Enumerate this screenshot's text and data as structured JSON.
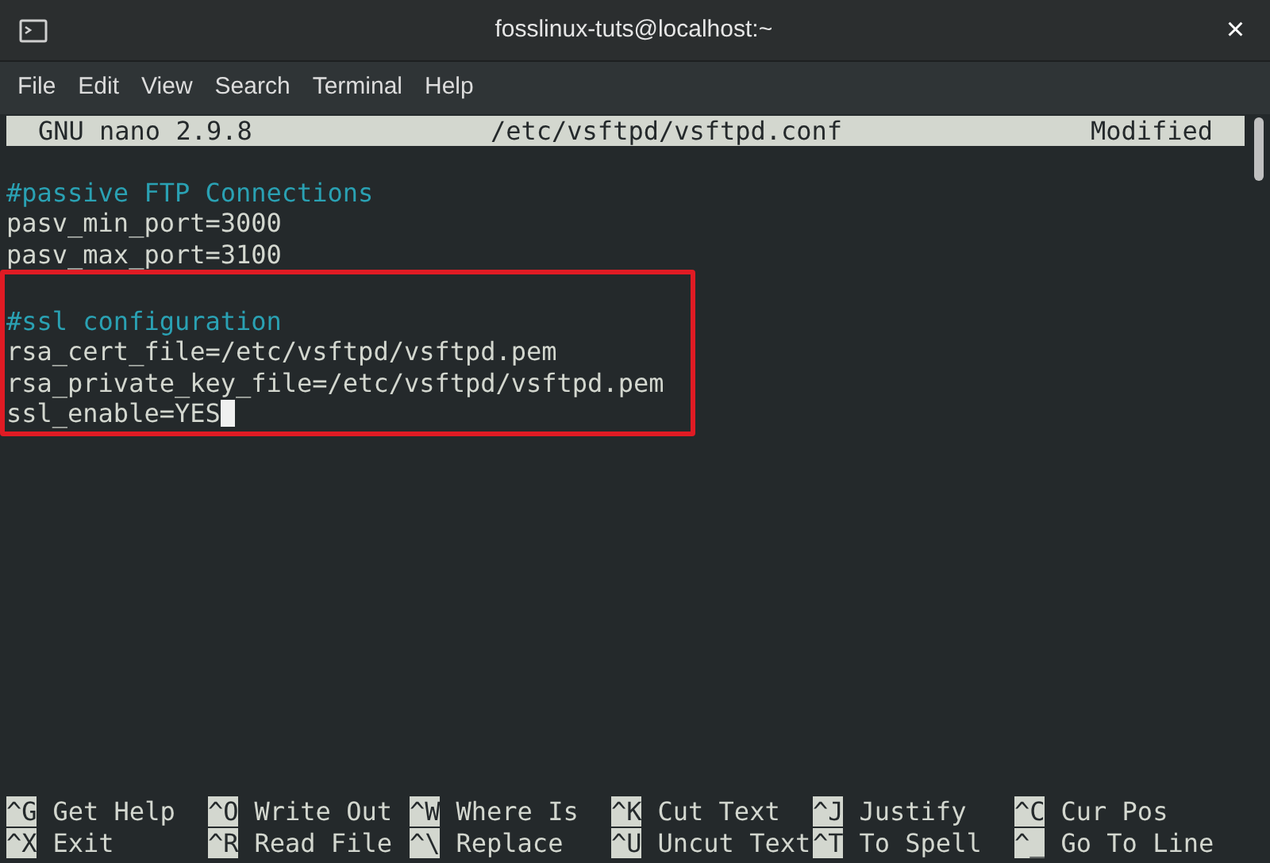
{
  "window": {
    "title": "fosslinux-tuts@localhost:~",
    "close": "×"
  },
  "menu": [
    "File",
    "Edit",
    "View",
    "Search",
    "Terminal",
    "Help"
  ],
  "nano_header": {
    "version": "GNU nano 2.9.8",
    "file": "/etc/vsftpd/vsftpd.conf",
    "status": "Modified"
  },
  "lines": [
    {
      "kind": "blank"
    },
    {
      "kind": "comment",
      "text": "#passive FTP Connections"
    },
    {
      "kind": "text",
      "text": "pasv_min_port=3000"
    },
    {
      "kind": "text",
      "text": "pasv_max_port=3100"
    }
  ],
  "highlight_box": {
    "lines": [
      {
        "kind": "blank"
      },
      {
        "kind": "comment",
        "text": "#ssl configuration"
      },
      {
        "kind": "text",
        "text": "rsa_cert_file=/etc/vsftpd/vsftpd.pem"
      },
      {
        "kind": "text",
        "text": "rsa_private_key_file=/etc/vsftpd/vsftpd.pem"
      },
      {
        "kind": "text",
        "text": "ssl_enable=YES"
      }
    ]
  },
  "cursor": true,
  "shortcuts": [
    [
      {
        "key": "^G",
        "label": "Get Help"
      },
      {
        "key": "^O",
        "label": "Write Out"
      },
      {
        "key": "^W",
        "label": "Where Is"
      },
      {
        "key": "^K",
        "label": "Cut Text"
      },
      {
        "key": "^J",
        "label": "Justify"
      },
      {
        "key": "^C",
        "label": "Cur Pos"
      }
    ],
    [
      {
        "key": "^X",
        "label": "Exit"
      },
      {
        "key": "^R",
        "label": "Read File"
      },
      {
        "key": "^\\",
        "label": "Replace"
      },
      {
        "key": "^U",
        "label": "Uncut Text"
      },
      {
        "key": "^T",
        "label": "To Spell"
      },
      {
        "key": "^_",
        "label": "Go To Line"
      }
    ]
  ]
}
